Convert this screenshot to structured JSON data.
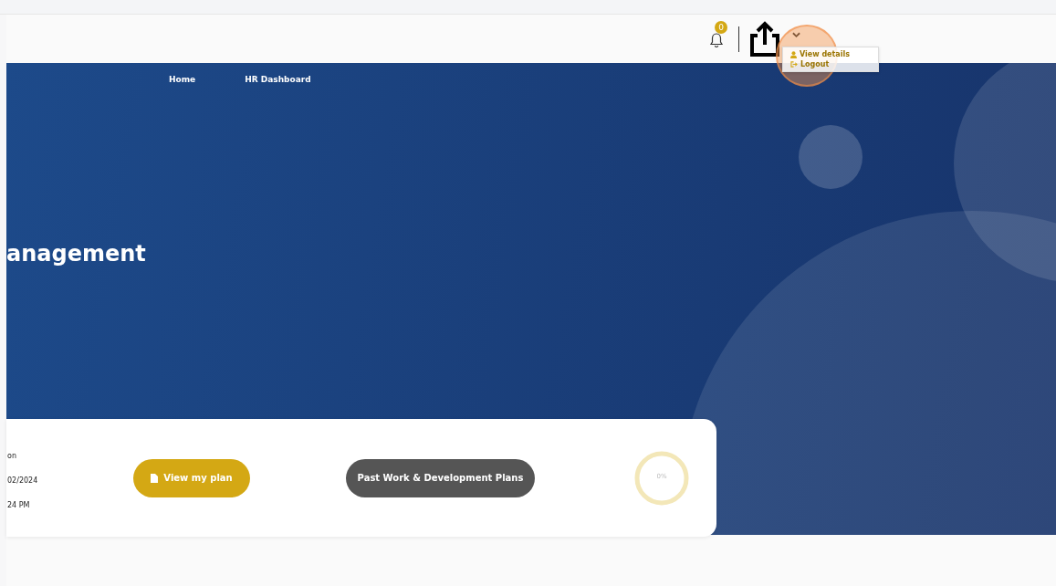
{
  "header": {
    "notification_count": "0",
    "user_menu": {
      "expanded": true,
      "items": [
        {
          "kind": "user",
          "label": "View details"
        },
        {
          "kind": "logout",
          "label": "Logout"
        }
      ]
    }
  },
  "nav": [
    {
      "label": "Home"
    },
    {
      "label": "HR Dashboard"
    }
  ],
  "hero": {
    "title": "anagement"
  },
  "plan_card": {
    "lines": [
      "on",
      "02/2024",
      "24 PM"
    ],
    "primary_button": "View my plan",
    "secondary_button": "Past Work & Development Plans",
    "progress": {
      "reading": "0%"
    }
  }
}
